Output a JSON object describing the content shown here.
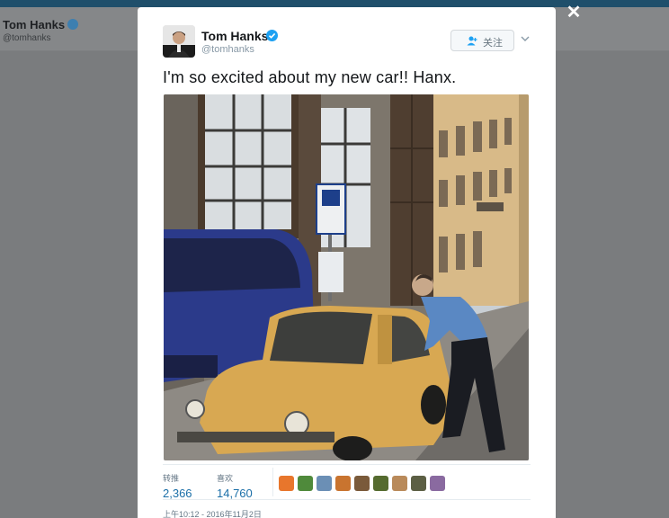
{
  "background_profile": {
    "name": "Tom Hanks",
    "handle": "@tomhanks"
  },
  "modal": {
    "close_icon": "close-icon",
    "author": {
      "name": "Tom Hanks",
      "handle": "@tomhanks",
      "verified": true
    },
    "follow_button": {
      "label": "关注",
      "icon": "follow-person-icon"
    },
    "more_menu_icon": "chevron-down-icon",
    "tweet_text": "I'm so excited about my new car!! Hanx.",
    "stats": {
      "retweets": {
        "label": "转推",
        "value": "2,366"
      },
      "likes": {
        "label": "喜欢",
        "value": "14,760"
      }
    },
    "liker_avatars": [
      "#e8762c",
      "#4f8a3b",
      "#6b8fb5",
      "#c9742f",
      "#7a5a3a",
      "#556b2f",
      "#b98a5a",
      "#5c5f44",
      "#8a6aa0"
    ],
    "timestamp": "上午10:12 - 2016年11月2日"
  },
  "colors": {
    "accent": "#1b6fa8",
    "verified": "#1da1f2",
    "topbar": "#1f4f6b"
  }
}
